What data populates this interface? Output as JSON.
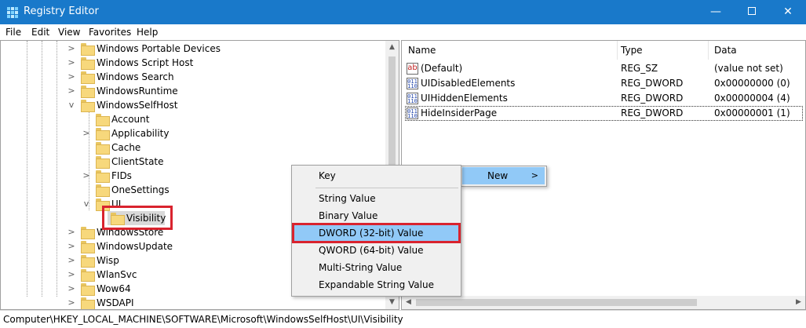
{
  "window": {
    "title": "Registry Editor",
    "minimize_glyph": "—",
    "close_glyph": "✕"
  },
  "menu": [
    "File",
    "Edit",
    "View",
    "Favorites",
    "Help"
  ],
  "tree": {
    "items": [
      {
        "label": "Windows Portable Devices",
        "expander": ">"
      },
      {
        "label": "Windows Script Host",
        "expander": ">"
      },
      {
        "label": "Windows Search",
        "expander": ">"
      },
      {
        "label": "WindowsRuntime",
        "expander": ">"
      },
      {
        "label": "WindowsSelfHost",
        "expander": "v"
      },
      {
        "label": "Account",
        "expander": ""
      },
      {
        "label": "Applicability",
        "expander": ">"
      },
      {
        "label": "Cache",
        "expander": ""
      },
      {
        "label": "ClientState",
        "expander": ""
      },
      {
        "label": "FIDs",
        "expander": ">"
      },
      {
        "label": "OneSettings",
        "expander": ""
      },
      {
        "label": "UI",
        "expander": "v"
      },
      {
        "label": "Visibility",
        "expander": ""
      },
      {
        "label": "WindowsStore",
        "expander": ">"
      },
      {
        "label": "WindowsUpdate",
        "expander": ">"
      },
      {
        "label": "Wisp",
        "expander": ">"
      },
      {
        "label": "WlanSvc",
        "expander": ">"
      },
      {
        "label": "Wow64",
        "expander": ">"
      },
      {
        "label": "WSDAPI",
        "expander": ">"
      }
    ]
  },
  "list": {
    "columns": [
      "Name",
      "Type",
      "Data"
    ],
    "rows": [
      {
        "name": "(Default)",
        "type": "REG_SZ",
        "data": "(value not set)",
        "icon": "string-value-icon",
        "icon_text": "ab"
      },
      {
        "name": "UIDisabledElements",
        "type": "REG_DWORD",
        "data": "0x00000000 (0)",
        "icon": "binary-value-icon",
        "icon_text": "011 110"
      },
      {
        "name": "UIHiddenElements",
        "type": "REG_DWORD",
        "data": "0x00000004 (4)",
        "icon": "binary-value-icon",
        "icon_text": "011 110"
      },
      {
        "name": "HideInsiderPage",
        "type": "REG_DWORD",
        "data": "0x00000001 (1)",
        "icon": "binary-value-icon",
        "icon_text": "011 110"
      }
    ]
  },
  "context_menu": {
    "new_label": "New",
    "new_arrow": ">",
    "items": [
      "Key",
      "String Value",
      "Binary Value",
      "DWORD (32-bit) Value",
      "QWORD (64-bit) Value",
      "Multi-String Value",
      "Expandable String Value"
    ],
    "highlighted": "DWORD (32-bit) Value"
  },
  "scroll": {
    "up": "▲",
    "down": "▼",
    "left": "◀",
    "right": "▶"
  },
  "status": {
    "path": "Computer\\HKEY_LOCAL_MACHINE\\SOFTWARE\\Microsoft\\WindowsSelfHost\\UI\\Visibility"
  },
  "colors": {
    "titlebar": "#1979ca",
    "highlight": "#91c9f7",
    "annotation_red": "#d9232e"
  }
}
